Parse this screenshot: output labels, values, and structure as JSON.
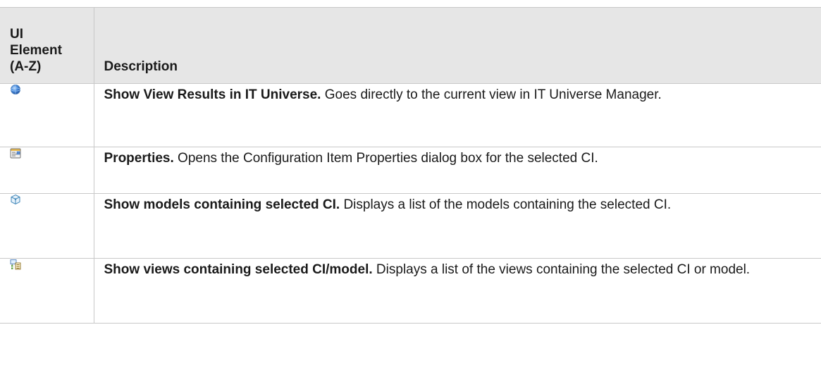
{
  "table": {
    "headers": {
      "ui_element_line1": "UI",
      "ui_element_line2": "Element",
      "ui_element_line3": "(A-Z)",
      "description": "Description"
    },
    "rows": [
      {
        "icon": "globe-icon",
        "title": "Show View Results in IT Universe.",
        "text": " Goes directly to the current view in IT Universe Manager."
      },
      {
        "icon": "properties-icon",
        "title": "Properties.",
        "text": " Opens the Configuration Item Properties dialog box for the selected CI."
      },
      {
        "icon": "model-cube-icon",
        "title": "Show models containing selected CI.",
        "text": " Displays a list of the models containing the selected CI."
      },
      {
        "icon": "views-containing-icon",
        "title": "Show views containing selected CI/model.",
        "text": " Displays a list of the views containing the selected CI or model."
      }
    ]
  }
}
